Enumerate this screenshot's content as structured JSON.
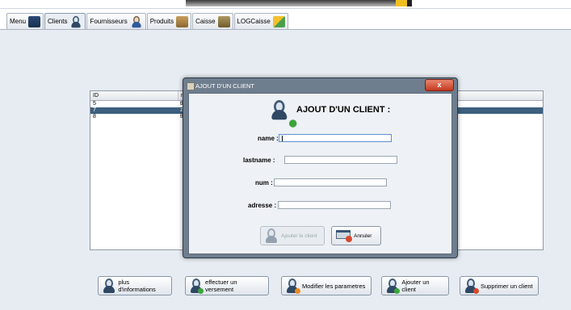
{
  "tabs": [
    {
      "label": "Menu",
      "icon": "monitor-icon"
    },
    {
      "label": "Clients",
      "icon": "user-icon"
    },
    {
      "label": "Fournisseurs",
      "icon": "supplier-icon"
    },
    {
      "label": "Produits",
      "icon": "box-icon"
    },
    {
      "label": "Caisse",
      "icon": "cash-register-icon"
    },
    {
      "label": "LOGCaisse",
      "icon": "log-icon"
    }
  ],
  "table": {
    "columns": [
      "ID",
      "na"
    ],
    "rows": [
      {
        "id": "5",
        "name": "th"
      },
      {
        "id": "7",
        "name": "zo"
      },
      {
        "id": "8",
        "name": "th"
      }
    ],
    "selected_row": 1
  },
  "buttons": {
    "more_info": "plus d'informations",
    "payment": "effectuer un versement",
    "modify": "Modifier les parametres",
    "add": "Ajouter un client",
    "delete": "Supprimer un client"
  },
  "dialog": {
    "title": "AJOUT D'UN CLIENT",
    "close_label": "x",
    "heading": "AJOUT D'UN CLIENT :",
    "fields": {
      "name_label": "name  :",
      "lastname_label": "lastname  :",
      "num_label": "num :",
      "adresse_label": "adresse :"
    },
    "values": {
      "name": "",
      "lastname": "",
      "num": "",
      "adresse": ""
    },
    "add_button": "Ajouter le client",
    "cancel_button": "Annuler"
  },
  "colors": {
    "selected_row": "#3d607f",
    "panel_bg": "#e6ecf2",
    "dialog_frame": "#6f7e8e",
    "close_button": "#c43a20"
  }
}
